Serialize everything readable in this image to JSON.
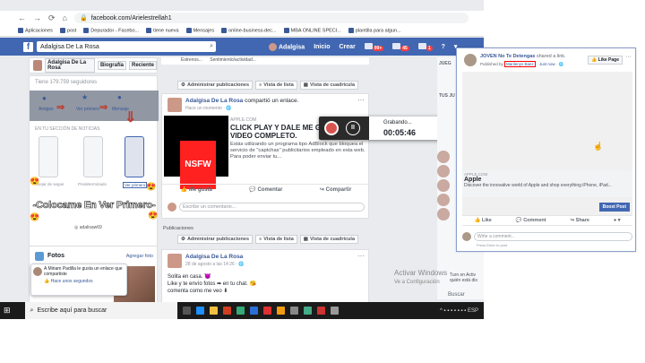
{
  "browser": {
    "url": "facebook.com/Arielestrellah1",
    "bookmarks": [
      "Aplicaciones",
      "post",
      "Depurador - Facebo...",
      "tiene nueva",
      "Mensajes",
      "online-business-dec...",
      "MBA ONLINE SPECI...",
      "plantilla para algun..."
    ]
  },
  "fb": {
    "search_value": "Adalgisa De La Rosa",
    "nav": {
      "name": "Adalgisa",
      "home": "Inicio",
      "create": "Crear"
    },
    "badges": [
      "99+",
      "45",
      "1"
    ]
  },
  "left": {
    "profile_name": "Adalgisa De La Rosa",
    "sel_bio": "Biografía",
    "sel_recent": "Reciente",
    "likes": "Tiene 179.759 seguidores",
    "opts": [
      "Amigos",
      "Ver primero",
      "Mensaje"
    ],
    "section": "EN TU SECCIÓN DE NOTICIAS",
    "phone_labels": [
      "Dejar de seguir",
      "Predeterminado",
      "Ver primero"
    ],
    "big": "-Colocame En Ver Primero-",
    "handle": "adalisaw69",
    "photos_title": "Fotos",
    "photos_add": "Agregar foto",
    "notif_text": "A Miriam Padilla le gusta un enlace que compartiste",
    "notif_time": "Hace unos segundos"
  },
  "feed": {
    "tabs_top": [
      "Estrenos...",
      "Sentimiento/actividad..."
    ],
    "toolbar": [
      "Administrar publicaciones",
      "Vista de lista",
      "Vista de cuadrícula"
    ],
    "post1": {
      "name": "Adalgisa De La Rosa",
      "action": "compartió un enlace.",
      "time": "Hace un momento",
      "nsfw": "NSFW",
      "domain": "APPLE.COM",
      "title": "CLICK PLAY Y DALE ME GUSTA EL VIDEO COMPLETO.",
      "desc": "Estás utilizando un programa tipo AdBlock que bloquea el servicio de \"captchas\" publicitarios empleado en esta web. Para poder enviar tu..."
    },
    "actions": [
      "Me gusta",
      "Comentar",
      "Compartir"
    ],
    "comment_ph": "Escribe un comentario...",
    "publicaciones": "Publicaciones",
    "post2": {
      "name": "Adalgisa De La Rosa",
      "time": "28 de agosto a las 14:26",
      "l1": "Solita en casa.",
      "l2": "Like y te envío fotos",
      "l2b": "en tu chat.",
      "l3": "comenta como me veo"
    }
  },
  "recorder": {
    "status": "Grabando...",
    "time": "00:05:46"
  },
  "right": {
    "h1": "JUEG",
    "h2": "TUS JU"
  },
  "windows": {
    "title": "Activar Windows",
    "sub": "Ve a Configuración",
    "turn": "Turn on Activ",
    "turn2": "quién está dis",
    "search": "Buscar"
  },
  "taskbar": {
    "search": "Escribe aquí para buscar",
    "lang": "ESP"
  },
  "overlay": {
    "page": "JOVEN No Te Detengas",
    "shared": "shared a link.",
    "pub_label": "Published by",
    "publisher": "Marilenys Baez",
    "when": "Just now",
    "like_page": "Like Page",
    "domain": "APPLE.COM",
    "title": "Apple",
    "desc": "Discover the innovative world of Apple and shop everything iPhone, iPad...",
    "boost": "Boost Post",
    "actions": [
      "Like",
      "Comment",
      "Share"
    ],
    "comment_ph": "Write a comment...",
    "press": "Press Enter to post."
  }
}
